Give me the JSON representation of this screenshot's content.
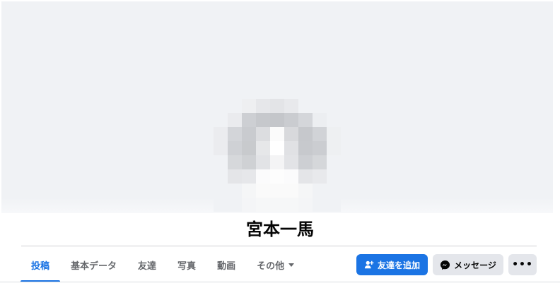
{
  "profile": {
    "name": "宮本一馬"
  },
  "tabs": [
    {
      "label": "投稿",
      "active": true
    },
    {
      "label": "基本データ",
      "active": false
    },
    {
      "label": "友達",
      "active": false
    },
    {
      "label": "写真",
      "active": false
    },
    {
      "label": "動画",
      "active": false
    },
    {
      "label": "その他",
      "active": false,
      "dropdown": true
    }
  ],
  "actions": {
    "add_friend_label": "友達を追加",
    "message_label": "メッセージ",
    "more_label": "•••"
  },
  "icons": {
    "add_friend": "person-plus-icon",
    "message": "messenger-icon",
    "more": "ellipsis-icon",
    "dropdown": "caret-down-icon"
  },
  "colors": {
    "accent": "#1b74e4",
    "cover": "#f0f2f5",
    "secondary_button": "#e4e6eb"
  }
}
